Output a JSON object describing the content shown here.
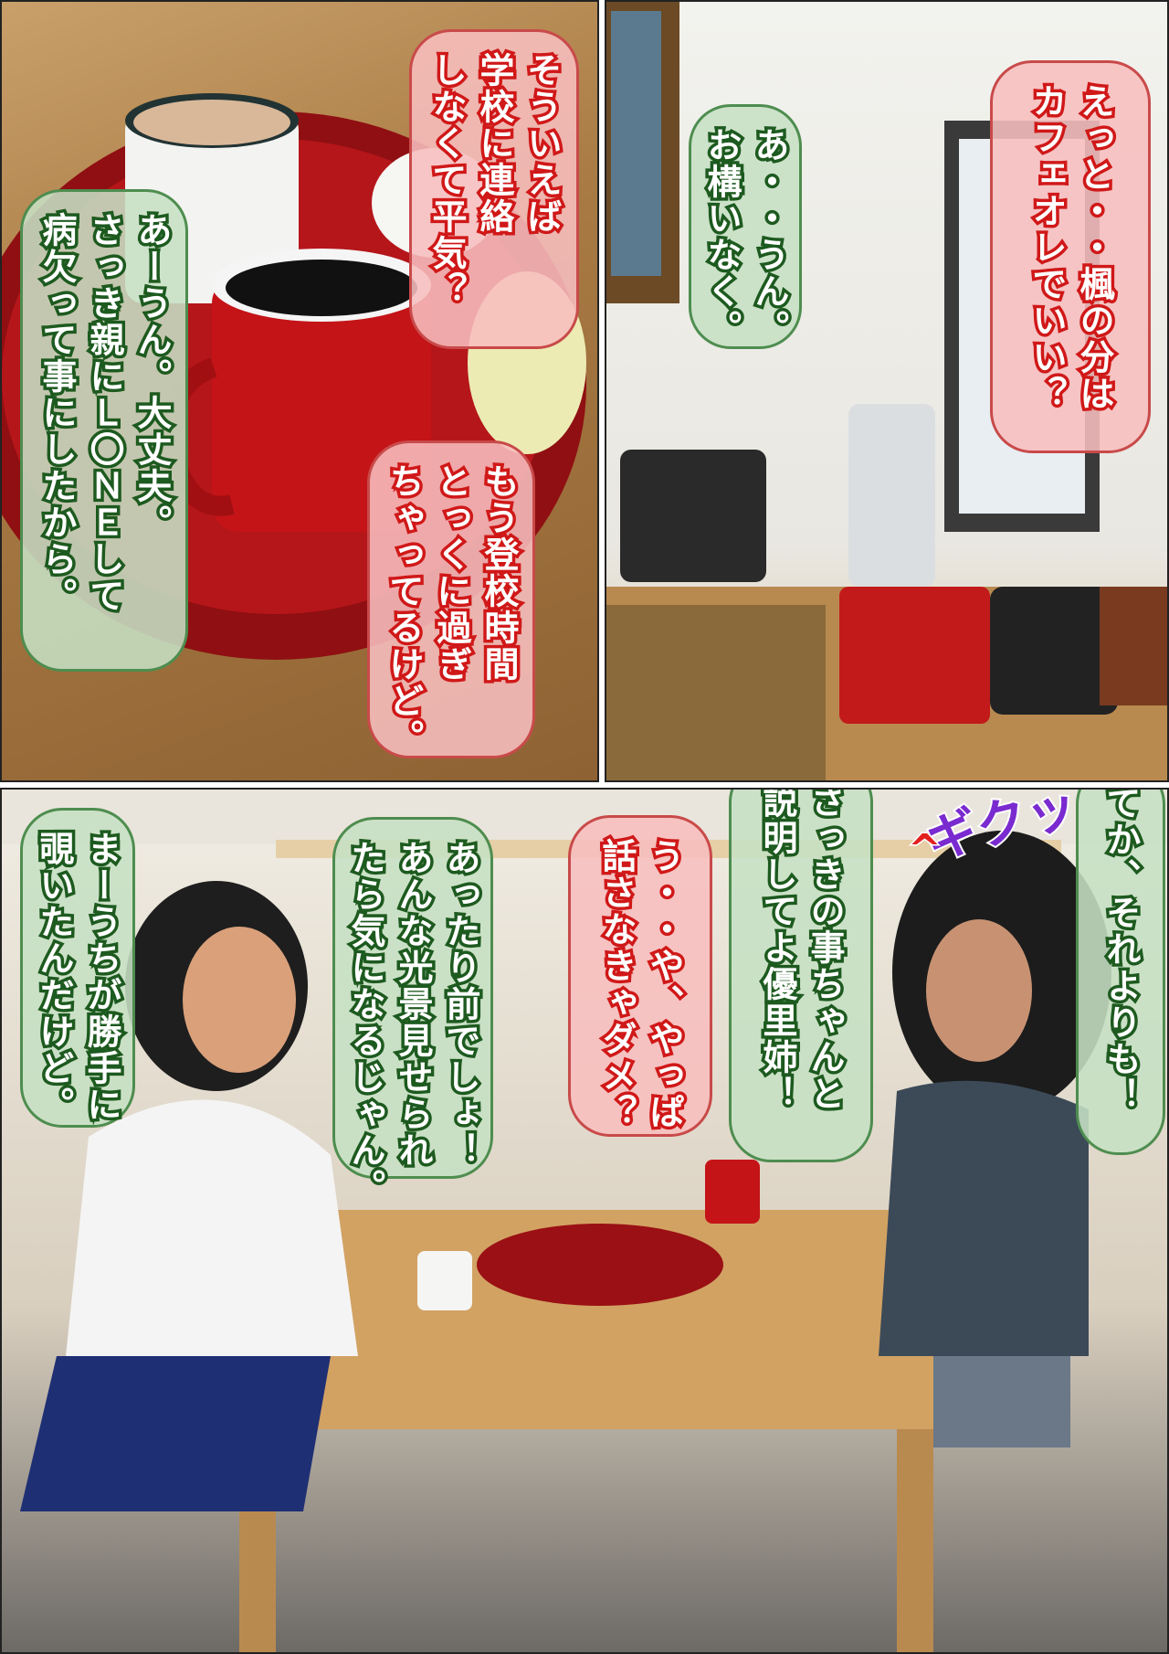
{
  "panels": {
    "top_left": {
      "bubbles": [
        {
          "style": "red",
          "text": "そういえば\n学校に連絡\nしなくて平気？"
        },
        {
          "style": "green",
          "text": "あーうん。大丈夫。\nさっき親にＬ〇ＮＥして\n病欠って事にしたから。"
        },
        {
          "style": "red",
          "text": "もう登校時間\nとっくに過ぎ\nちゃってるけど。"
        }
      ]
    },
    "top_right": {
      "bubbles": [
        {
          "style": "red",
          "text": "えっと・・楓の分は\nカフェオレでいい？"
        },
        {
          "style": "green",
          "text": "あ・・うん。\nお構いなく。"
        }
      ]
    },
    "bottom": {
      "sfx": "ギクッ",
      "sfx_mark": "^",
      "bubbles": [
        {
          "style": "green",
          "text": "てか、それよりも！"
        },
        {
          "style": "green",
          "text": "さっきの事ちゃんと\n説明してよ優里姉！"
        },
        {
          "style": "red",
          "text": "う・・や、やっぱ\n話さなきゃダメ？"
        },
        {
          "style": "green",
          "text": "あったり前でしょ！\nあんな光景見せられ\nたら気になるじゃん。"
        },
        {
          "style": "green",
          "text": "まーうちが勝手に\n覗いたんだけど。"
        }
      ]
    }
  }
}
